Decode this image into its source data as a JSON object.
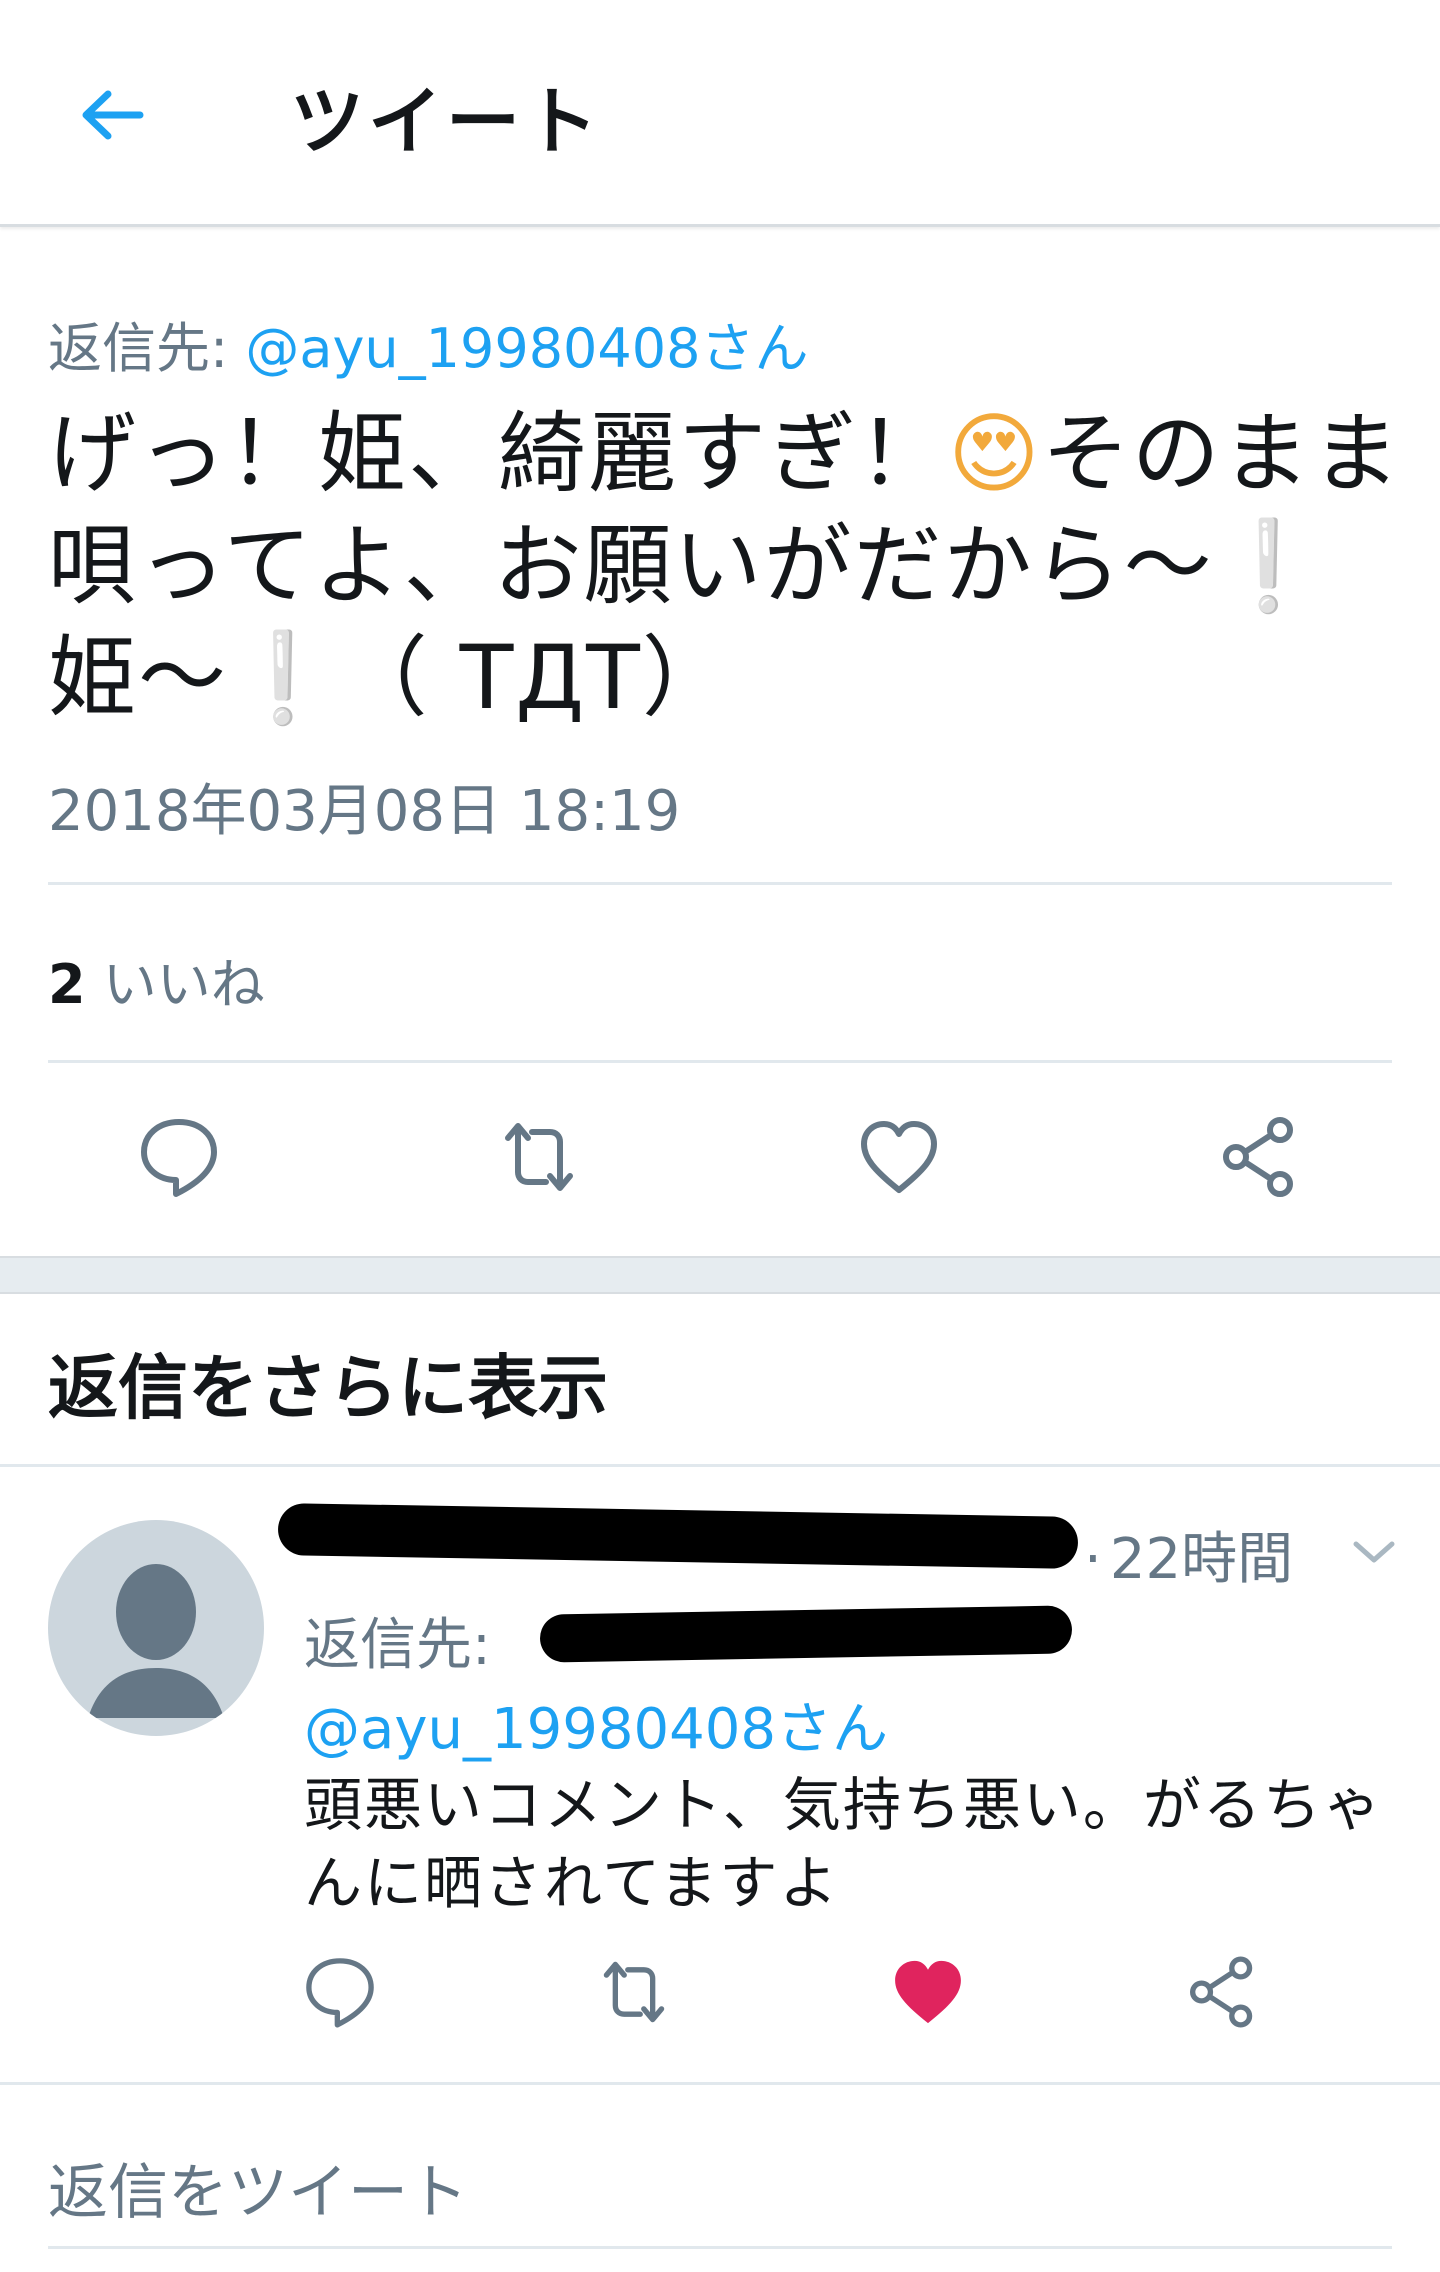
{
  "header": {
    "title": "ツイート",
    "back_icon": "back-arrow-icon"
  },
  "tweet": {
    "reply_to_label": "返信先: ",
    "reply_to_handle": "@ayu_19980408さん",
    "text_1": "げっ！姫、綺麗すぎ！",
    "emoji": "😍",
    "text_2": "そのまま唄ってよ、お願いがだから〜",
    "excl_1": "❕",
    "text_3": "姫〜",
    "excl_2": "❕",
    "text_4": "（ TДT）",
    "timestamp": "2018年03月08日 18:19",
    "likes_count": "2",
    "likes_label": " いいね"
  },
  "more_replies": {
    "label": "返信をさらに表示"
  },
  "reply": {
    "time_dot": "·",
    "time": "22時間",
    "reply_to_label": "返信先: ",
    "reply_to_handle": "@ayu_19980408さん",
    "text": "頭悪いコメント、気持ち悪い。がるちゃんに晒されてますよ",
    "liked": true
  },
  "compose": {
    "placeholder": "返信をツイート"
  },
  "colors": {
    "accent": "#1da1f2",
    "secondary_text": "#657786",
    "like": "#e0245e",
    "divider": "#e1e8ed"
  },
  "icons": [
    "back-arrow-icon",
    "reply-icon",
    "retweet-icon",
    "like-icon",
    "share-icon",
    "chevron-down-icon"
  ]
}
